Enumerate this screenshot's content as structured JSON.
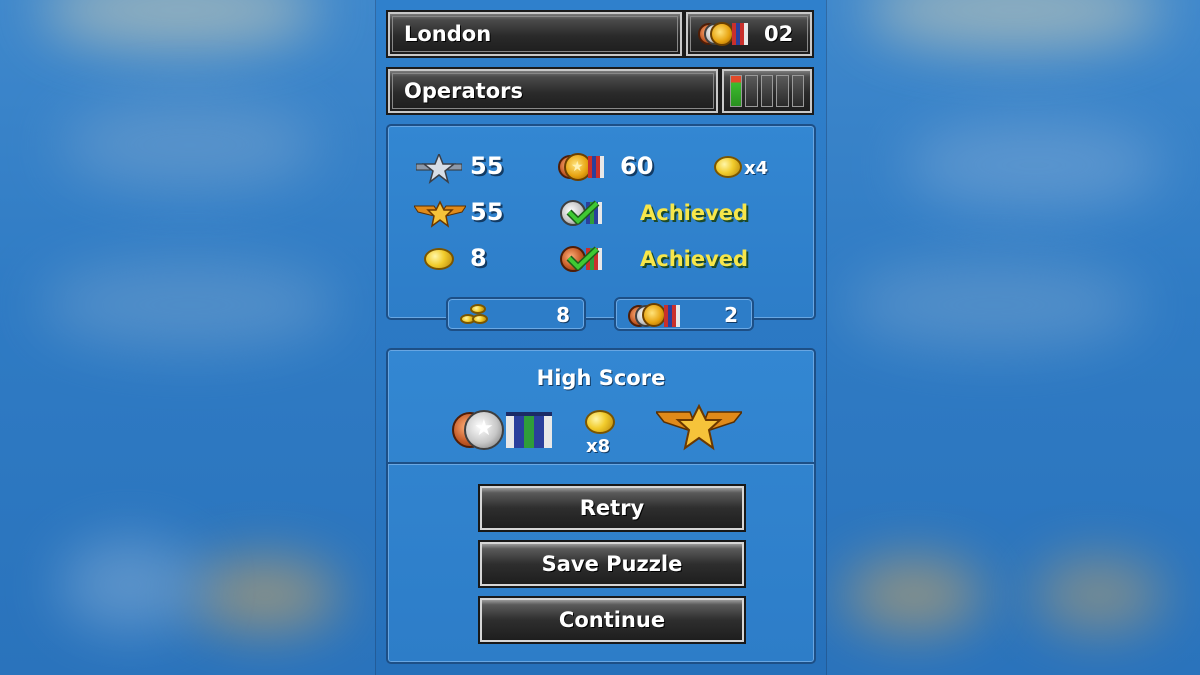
{
  "level": {
    "city": "London",
    "medal_count": "02",
    "stage": "Operators",
    "progress_segments_total": 5,
    "progress_segments_filled": 1
  },
  "stats": {
    "silver_star_score": "55",
    "gold_wings_score": "55",
    "coins": "8",
    "medal_requirement": "60",
    "coin_multiplier": "x4",
    "silver_objective_status": "Achieved",
    "bronze_objective_status": "Achieved"
  },
  "totals": {
    "coin_stack_total": "8",
    "medal_total": "2"
  },
  "high_score": {
    "title": "High Score",
    "coin_multiplier": "x8"
  },
  "buttons": {
    "retry": "Retry",
    "save_puzzle": "Save Puzzle",
    "continue": "Continue"
  },
  "colors": {
    "achieved_text": "#f7e64a",
    "progress_fill": "#3cbd2e",
    "panel_border": "#1d4f86"
  },
  "icons": {
    "silver_star": "silver-star-rank-icon",
    "gold_wings": "gold-wings-rank-icon",
    "coin": "coin-icon",
    "gold_medal": "gold-medal-icon",
    "silver_medal_check": "silver-medal-check-icon",
    "bronze_medal_check": "bronze-medal-check-icon",
    "coin_stack": "coin-stack-icon",
    "medal_group": "medal-group-icon"
  }
}
